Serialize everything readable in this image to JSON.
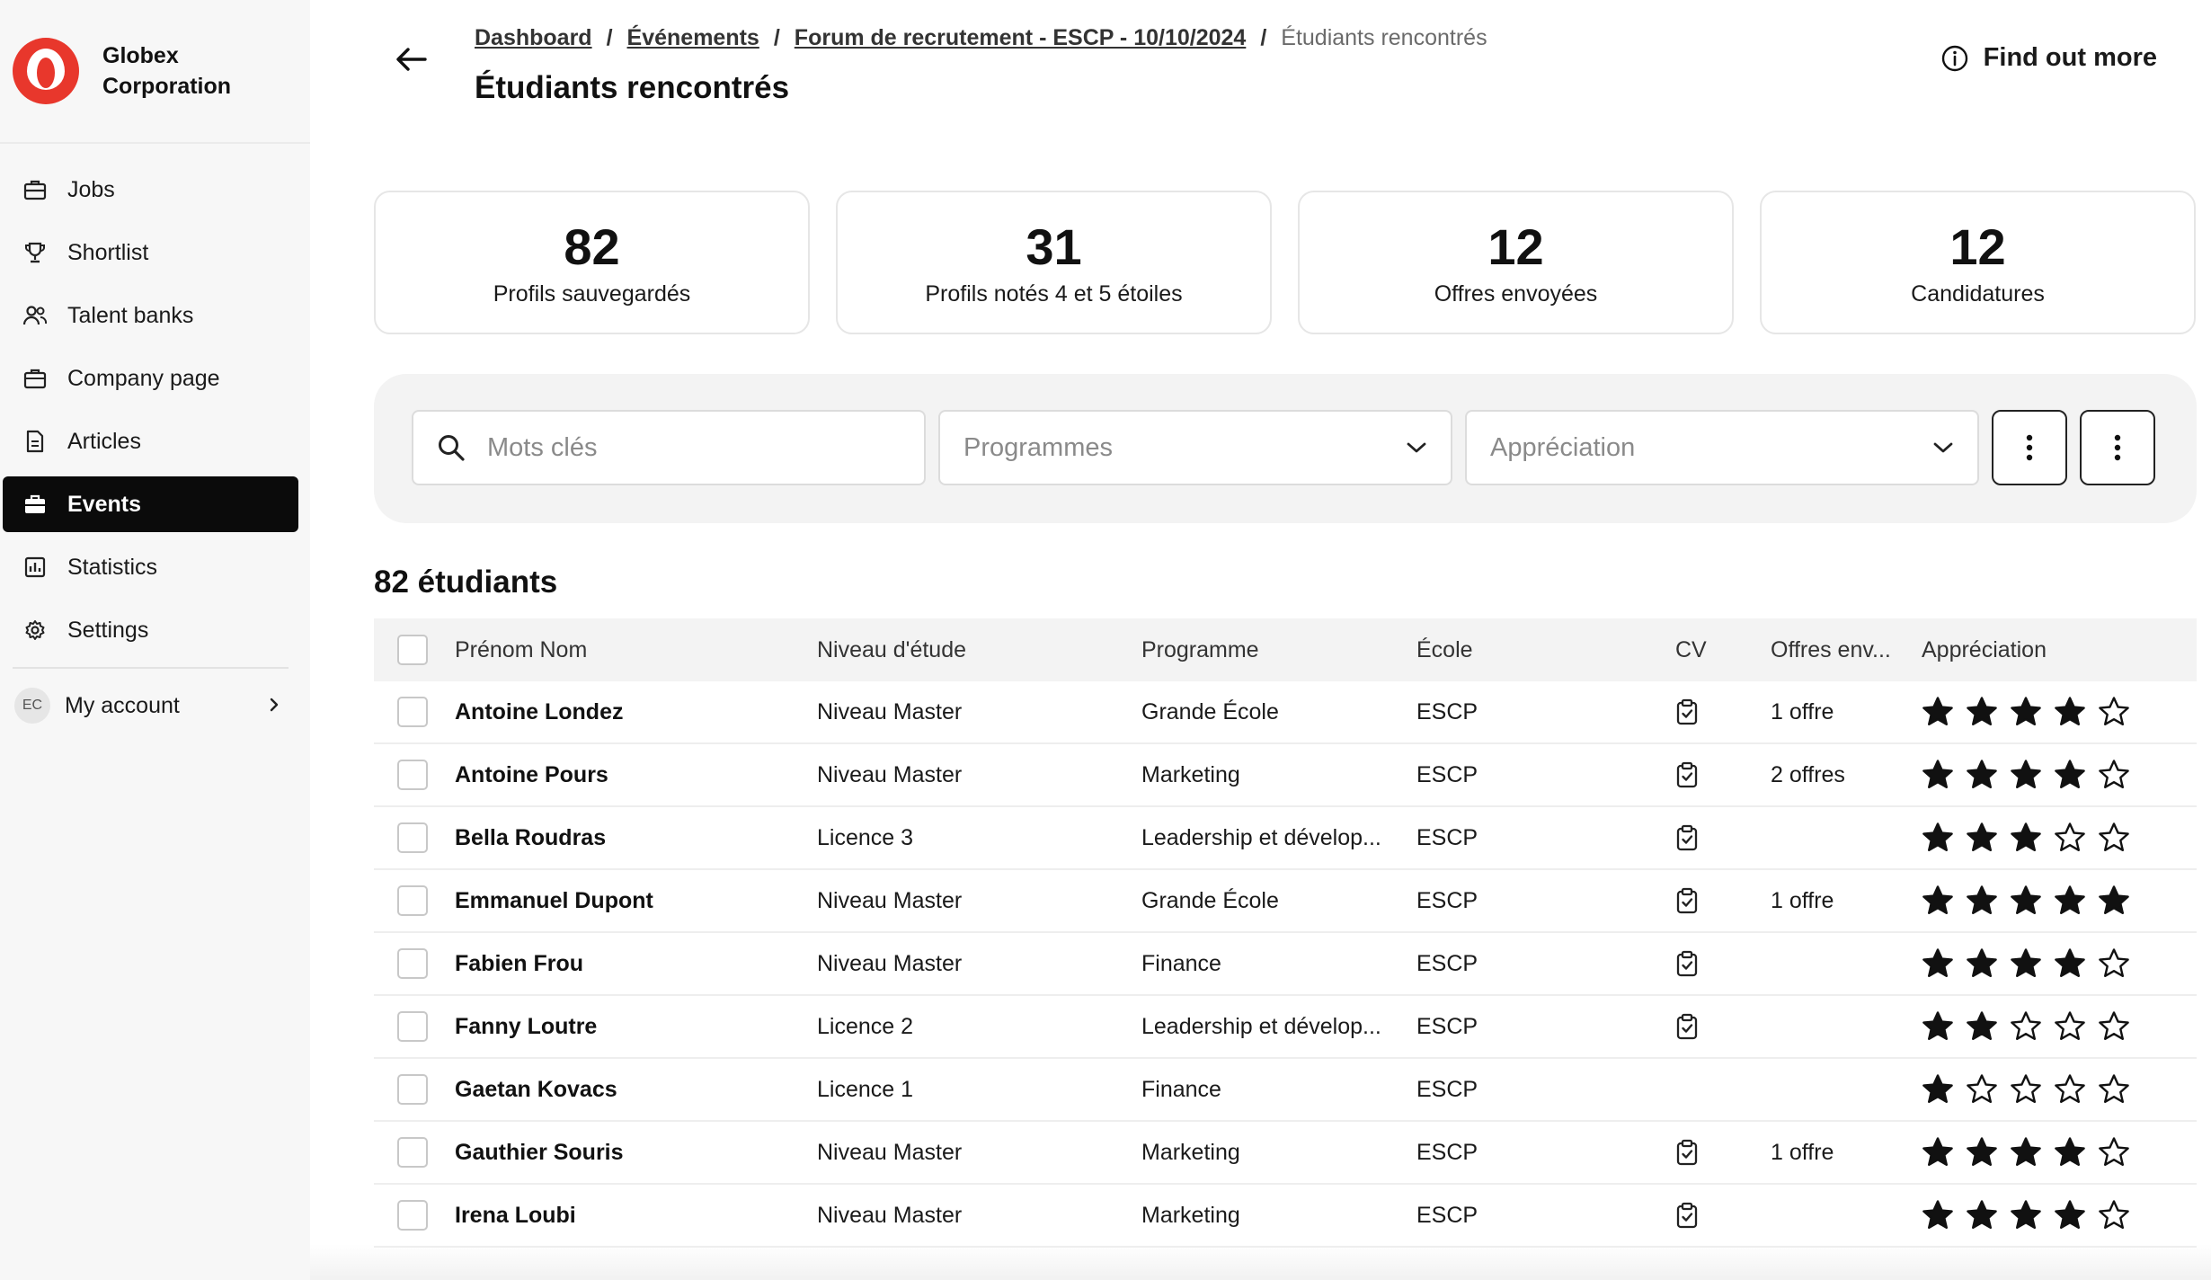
{
  "brand": {
    "name": "Globex Corporation",
    "brand_color": "#e8372c"
  },
  "sidebar": {
    "items": [
      {
        "label": "Jobs",
        "icon": "briefcase-icon",
        "active": false
      },
      {
        "label": "Shortlist",
        "icon": "trophy-icon",
        "active": false
      },
      {
        "label": "Talent banks",
        "icon": "users-icon",
        "active": false
      },
      {
        "label": "Company page",
        "icon": "briefcase-outline-icon",
        "active": false
      },
      {
        "label": "Articles",
        "icon": "document-icon",
        "active": false
      },
      {
        "label": "Events",
        "icon": "briefcase-filled-icon",
        "active": true
      },
      {
        "label": "Statistics",
        "icon": "bar-chart-icon",
        "active": false
      },
      {
        "label": "Settings",
        "icon": "gear-icon",
        "active": false
      }
    ],
    "account": {
      "initials": "EC",
      "label": "My account"
    }
  },
  "header": {
    "breadcrumb": [
      "Dashboard",
      "Événements",
      "Forum de recrutement - ESCP - 10/10/2024"
    ],
    "breadcrumb_current": "Étudiants rencontrés",
    "title": "Étudiants rencontrés",
    "find_more": "Find out more"
  },
  "stats": [
    {
      "value": "82",
      "label": "Profils sauvegardés"
    },
    {
      "value": "31",
      "label": "Profils notés 4 et 5 étoiles"
    },
    {
      "value": "12",
      "label": "Offres envoyées"
    },
    {
      "value": "12",
      "label": "Candidatures"
    }
  ],
  "filters": {
    "search_placeholder": "Mots clés",
    "programmes": "Programmes",
    "appreciation": "Appréciation"
  },
  "table": {
    "count_label": "82 étudiants",
    "columns": [
      "Prénom Nom",
      "Niveau d'étude",
      "Programme",
      "École",
      "CV",
      "Offres env...",
      "Appréciation"
    ],
    "rows": [
      {
        "name": "Antoine Londez",
        "level": "Niveau Master",
        "programme": "Grande École",
        "school": "ESCP",
        "cv": true,
        "offers": "1 offre",
        "rating": 4
      },
      {
        "name": "Antoine Pours",
        "level": "Niveau Master",
        "programme": "Marketing",
        "school": "ESCP",
        "cv": true,
        "offers": "2 offres",
        "rating": 4
      },
      {
        "name": "Bella Roudras",
        "level": "Licence 3",
        "programme": "Leadership et dévelop...",
        "school": "ESCP",
        "cv": true,
        "offers": "",
        "rating": 3
      },
      {
        "name": "Emmanuel Dupont",
        "level": "Niveau Master",
        "programme": "Grande École",
        "school": "ESCP",
        "cv": true,
        "offers": "1 offre",
        "rating": 5
      },
      {
        "name": "Fabien Frou",
        "level": "Niveau Master",
        "programme": "Finance",
        "school": "ESCP",
        "cv": true,
        "offers": "",
        "rating": 4
      },
      {
        "name": "Fanny Loutre",
        "level": "Licence 2",
        "programme": "Leadership et dévelop...",
        "school": "ESCP",
        "cv": true,
        "offers": "",
        "rating": 2
      },
      {
        "name": "Gaetan Kovacs",
        "level": "Licence 1",
        "programme": "Finance",
        "school": "ESCP",
        "cv": false,
        "offers": "",
        "rating": 1
      },
      {
        "name": "Gauthier Souris",
        "level": "Niveau Master",
        "programme": "Marketing",
        "school": "ESCP",
        "cv": true,
        "offers": "1 offre",
        "rating": 4
      },
      {
        "name": "Irena Loubi",
        "level": "Niveau Master",
        "programme": "Marketing",
        "school": "ESCP",
        "cv": true,
        "offers": "",
        "rating": 4
      }
    ]
  }
}
